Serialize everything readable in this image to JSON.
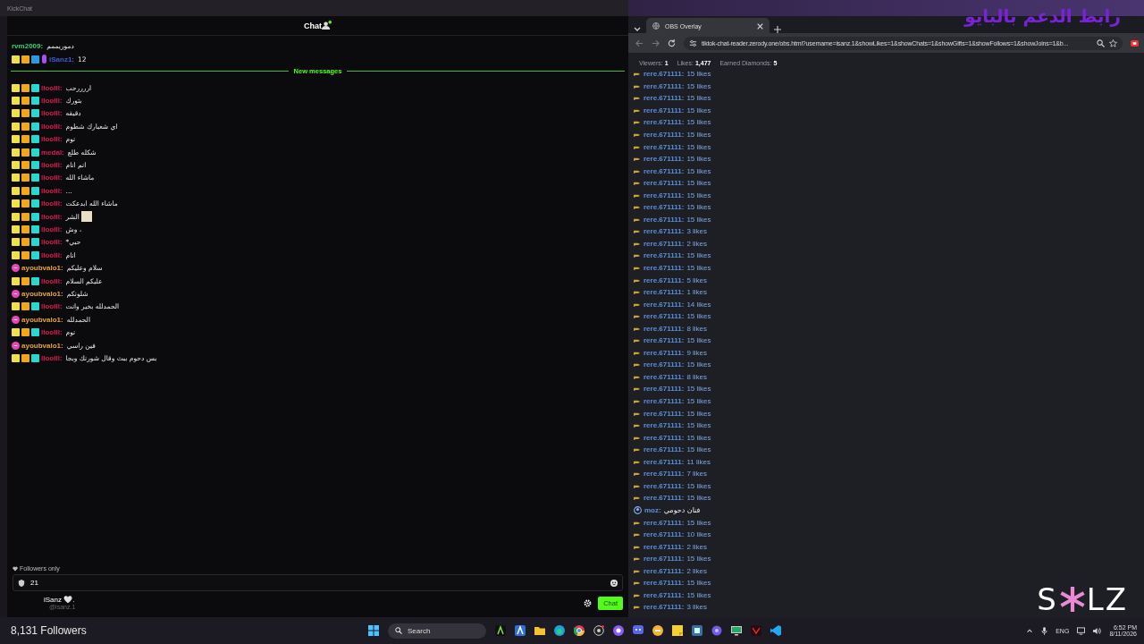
{
  "chat_window": {
    "title": "KickChat",
    "header": "Chat",
    "new_messages_label": "New messages",
    "pinned_messages": [
      {
        "kind": "plain",
        "user": "rvm2009:",
        "color": "#2fd17a",
        "text": "دموريممم"
      },
      {
        "kind": "moderator",
        "user": "iSanz1:",
        "color": "#3b5bdb",
        "text": "12"
      }
    ],
    "messages": [
      {
        "kind": "badged",
        "user": "lloolll:",
        "color": "#e0174f",
        "text": "اررررحب"
      },
      {
        "kind": "badged",
        "user": "lloolll:",
        "color": "#e0174f",
        "text": "بتورك"
      },
      {
        "kind": "badged",
        "user": "lloolll:",
        "color": "#e0174f",
        "text": "دقيقه"
      },
      {
        "kind": "badged",
        "user": "lloolll:",
        "color": "#e0174f",
        "text": "اي شعبارك شطوم"
      },
      {
        "kind": "badged",
        "user": "lloolll:",
        "color": "#e0174f",
        "text": "نوم"
      },
      {
        "kind": "badged",
        "user": "medal:",
        "color": "#e0174f",
        "text": "شكله طلع"
      },
      {
        "kind": "badged",
        "user": "lloolll:",
        "color": "#e0174f",
        "text": "انم انام"
      },
      {
        "kind": "badged",
        "user": "lloolll:",
        "color": "#e0174f",
        "text": "ماشاء الله"
      },
      {
        "kind": "badged",
        "user": "lloolll:",
        "color": "#e0174f",
        "text": "..."
      },
      {
        "kind": "badged",
        "user": "lloolll:",
        "color": "#e0174f",
        "text": "ماشاء الله ابدعكت"
      },
      {
        "kind": "badged",
        "user": "lloolll:",
        "color": "#e0174f",
        "text": "الشر",
        "emote": true
      },
      {
        "kind": "badged",
        "user": "lloolll:",
        "color": "#e0174f",
        "text": "وش ،"
      },
      {
        "kind": "badged",
        "user": "lloolll:",
        "color": "#e0174f",
        "text": "*حبي"
      },
      {
        "kind": "badged",
        "user": "lloolll:",
        "color": "#e0174f",
        "text": "انام"
      },
      {
        "kind": "pink",
        "user": "ayoubvalo1:",
        "color": "#e8a532",
        "text": "سلام وعليكم"
      },
      {
        "kind": "badged",
        "user": "lloolll:",
        "color": "#e0174f",
        "text": "عليكم السلام"
      },
      {
        "kind": "pink",
        "user": "ayoubvalo1:",
        "color": "#e8a532",
        "text": "شلونكم"
      },
      {
        "kind": "badged",
        "user": "lloolll:",
        "color": "#e0174f",
        "text": "الحمدلله بخير وانت"
      },
      {
        "kind": "pink",
        "user": "ayoubvalo1:",
        "color": "#e8a532",
        "text": "الحمدلله"
      },
      {
        "kind": "badged",
        "user": "lloolll:",
        "color": "#e0174f",
        "text": "نوم"
      },
      {
        "kind": "pink",
        "user": "ayoubvalo1:",
        "color": "#e8a532",
        "text": "فين راسي"
      },
      {
        "kind": "badged",
        "user": "lloolll:",
        "color": "#e0174f",
        "text": "بس دحوم ببث وقال شورنك وبجا"
      }
    ],
    "followers_only_label": "Followers only",
    "input": {
      "value": "21"
    },
    "profile": {
      "name": "iSanz 🤍.",
      "handle": "@isanz.1"
    },
    "send_button": "Chat"
  },
  "browser": {
    "tabs": [
      {
        "label": "OBS Overlay",
        "selected": true
      }
    ],
    "url": "tiktok-chat-reader.zerody.one/obs.html?username=isanz.1&showLikes=1&showChats=1&showGifts=1&showFollows=1&showJoins=1&b...",
    "stats": [
      {
        "label": "Viewers:",
        "value": "1"
      },
      {
        "label": "Likes:",
        "value": "1,477"
      },
      {
        "label": "Earned Diamonds:",
        "value": "5"
      }
    ],
    "events": [
      {
        "kind": "like",
        "user": "rere.671111:",
        "text": "15 likes"
      },
      {
        "kind": "like",
        "user": "rere.671111:",
        "text": "15 likes"
      },
      {
        "kind": "like",
        "user": "rere.671111:",
        "text": "15 likes"
      },
      {
        "kind": "like",
        "user": "rere.671111:",
        "text": "15 likes"
      },
      {
        "kind": "like",
        "user": "rere.671111:",
        "text": "15 likes"
      },
      {
        "kind": "like",
        "user": "rere.671111:",
        "text": "15 likes"
      },
      {
        "kind": "like",
        "user": "rere.671111:",
        "text": "15 likes"
      },
      {
        "kind": "like",
        "user": "rere.671111:",
        "text": "15 likes"
      },
      {
        "kind": "like",
        "user": "rere.671111:",
        "text": "15 likes"
      },
      {
        "kind": "like",
        "user": "rere.671111:",
        "text": "15 likes"
      },
      {
        "kind": "like",
        "user": "rere.671111:",
        "text": "15 likes"
      },
      {
        "kind": "like",
        "user": "rere.671111:",
        "text": "15 likes"
      },
      {
        "kind": "like",
        "user": "rere.671111:",
        "text": "15 likes"
      },
      {
        "kind": "like",
        "user": "rere.671111:",
        "text": "3 likes"
      },
      {
        "kind": "like",
        "user": "rere.671111:",
        "text": "2 likes"
      },
      {
        "kind": "like",
        "user": "rere.671111:",
        "text": "15 likes"
      },
      {
        "kind": "like",
        "user": "rere.671111:",
        "text": "15 likes"
      },
      {
        "kind": "like",
        "user": "rere.671111:",
        "text": "5 likes"
      },
      {
        "kind": "like",
        "user": "rere.671111:",
        "text": "1 likes"
      },
      {
        "kind": "like",
        "user": "rere.671111:",
        "text": "14 likes"
      },
      {
        "kind": "like",
        "user": "rere.671111:",
        "text": "15 likes"
      },
      {
        "kind": "like",
        "user": "rere.671111:",
        "text": "8 likes"
      },
      {
        "kind": "like",
        "user": "rere.671111:",
        "text": "15 likes"
      },
      {
        "kind": "like",
        "user": "rere.671111:",
        "text": "9 likes"
      },
      {
        "kind": "like",
        "user": "rere.671111:",
        "text": "15 likes"
      },
      {
        "kind": "like",
        "user": "rere.671111:",
        "text": "8 likes"
      },
      {
        "kind": "like",
        "user": "rere.671111:",
        "text": "15 likes"
      },
      {
        "kind": "like",
        "user": "rere.671111:",
        "text": "15 likes"
      },
      {
        "kind": "like",
        "user": "rere.671111:",
        "text": "15 likes"
      },
      {
        "kind": "like",
        "user": "rere.671111:",
        "text": "15 likes"
      },
      {
        "kind": "like",
        "user": "rere.671111:",
        "text": "15 likes"
      },
      {
        "kind": "like",
        "user": "rere.671111:",
        "text": "15 likes"
      },
      {
        "kind": "like",
        "user": "rere.671111:",
        "text": "11 likes"
      },
      {
        "kind": "like",
        "user": "rere.671111:",
        "text": "7 likes"
      },
      {
        "kind": "like",
        "user": "rere.671111:",
        "text": "15 likes"
      },
      {
        "kind": "like",
        "user": "rere.671111:",
        "text": "15 likes"
      },
      {
        "kind": "chat",
        "user": "moz:",
        "text": "فنان دحومي"
      },
      {
        "kind": "like",
        "user": "rere.671111:",
        "text": "15 likes"
      },
      {
        "kind": "like",
        "user": "rere.671111:",
        "text": "10 likes"
      },
      {
        "kind": "like",
        "user": "rere.671111:",
        "text": "2 likes"
      },
      {
        "kind": "like",
        "user": "rere.671111:",
        "text": "15 likes"
      },
      {
        "kind": "like",
        "user": "rere.671111:",
        "text": "2 likes"
      },
      {
        "kind": "like",
        "user": "rere.671111:",
        "text": "15 likes"
      },
      {
        "kind": "like",
        "user": "rere.671111:",
        "text": "15 likes"
      },
      {
        "kind": "like",
        "user": "rere.671111:",
        "text": "3 likes"
      }
    ]
  },
  "overlay": {
    "banner": "رابط الدعم بالبايو",
    "followers": "8,131 Followers",
    "logo_left": "S",
    "logo_right": "LZ"
  },
  "taskbar": {
    "search_placeholder": "Search",
    "language": "ENG",
    "time": "6:52 PM",
    "date": "8/11/2026"
  }
}
